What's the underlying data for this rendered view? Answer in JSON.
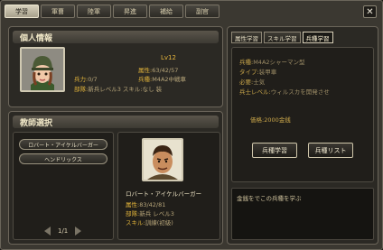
{
  "tabs": [
    "学習",
    "軍曹",
    "陸軍",
    "昇進",
    "補給",
    "副官"
  ],
  "close_label": "✕",
  "personal": {
    "title": "個人情報",
    "level": "Lv12",
    "lines": [
      {
        "k": "属性:",
        "v": "63/42/57"
      },
      {
        "k": "兵種:",
        "v": "M4A2中戦車"
      },
      {
        "k": "兵力:",
        "v": "0/7"
      },
      {
        "k": "部隊:",
        "v": "新兵レベル3 スキル:なし 装"
      }
    ]
  },
  "teacher": {
    "title": "教師選択",
    "buttons": [
      "ロバート・アイケルバーガー",
      "ヘンドリックス"
    ],
    "page": "1/1",
    "name": "ロバート・アイケルバーガー",
    "lines": [
      {
        "k": "属性:",
        "v": "83/42/81"
      },
      {
        "k": "部隊:",
        "v": "新兵 レベル3"
      },
      {
        "k": "スキル:",
        "v": "訓練(初級)"
      }
    ]
  },
  "right": {
    "tabs": [
      "属性学習",
      "スキル学習",
      "兵種学習"
    ],
    "active_tab": 2,
    "lines": [
      {
        "k": "兵種:",
        "v": "M4A2シャーマン型"
      },
      {
        "k": "タイプ:",
        "v": "装甲車"
      },
      {
        "k": "必要:",
        "v": "士気"
      },
      {
        "k": "兵士レベル:",
        "v": "ウィルスカを開発させ"
      }
    ],
    "price": "価格:2000金銭",
    "btn_learn": "兵種学習",
    "btn_list": "兵種リスト",
    "desc": "金銭をでこの兵種を学ぶ"
  }
}
